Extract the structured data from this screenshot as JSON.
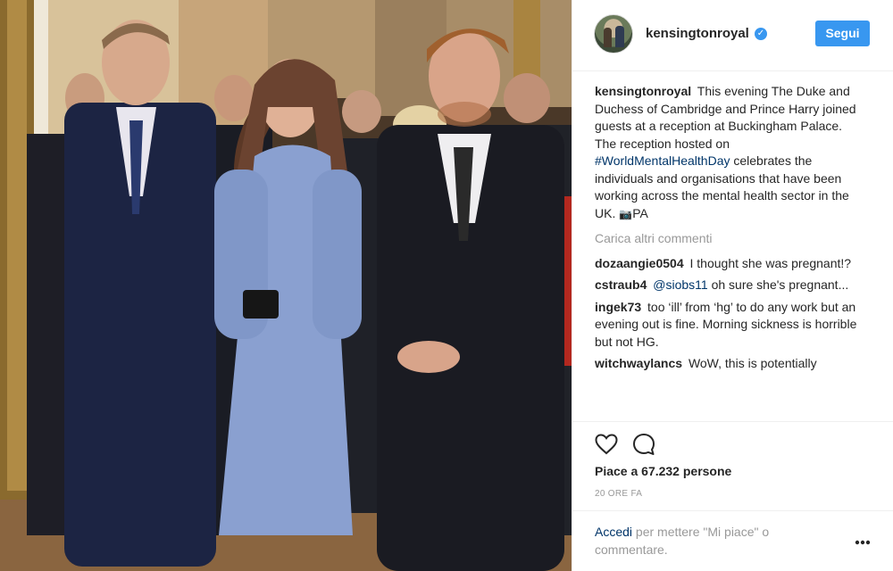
{
  "post": {
    "username": "kensingtonroyal",
    "follow_label": "Segui",
    "verified_label": "✓",
    "caption": {
      "username": "kensingtonroyal",
      "text_before_hashtag": "This evening The Duke and Duchess of Cambridge and Prince Harry joined guests at a reception at Buckingham Palace. The reception hosted on",
      "hashtag": "#WorldMentalHealthDay",
      "text_after_hashtag": "celebrates the individuals and organisations that have been working across the mental health sector in the UK.",
      "camera_emoji": "📷",
      "credit": "PA"
    },
    "load_more_label": "Carica altri commenti",
    "comments": [
      {
        "username": "dozaangie0504",
        "mention": "",
        "text": "I thought she was pregnant!?"
      },
      {
        "username": "cstraub4",
        "mention": "@siobs11",
        "text": "oh sure she's pregnant..."
      },
      {
        "username": "ingek73",
        "mention": "",
        "text": "too ‘ill’ from ‘hg’ to do any work but an evening out is fine. Morning sickness is horrible but not HG."
      },
      {
        "username": "witchwaylancs",
        "mention": "",
        "text": "WoW, this is potentially"
      }
    ],
    "likes_text": "Piace a 67.232 persone",
    "time_ago": "20 ORE FA",
    "footer": {
      "login_link": "Accedi",
      "rest": "per mettere \"Mi piace\" o commentare."
    }
  },
  "colors": {
    "accent": "#3897f0",
    "link": "#003569",
    "muted": "#999999",
    "text": "#262626"
  }
}
